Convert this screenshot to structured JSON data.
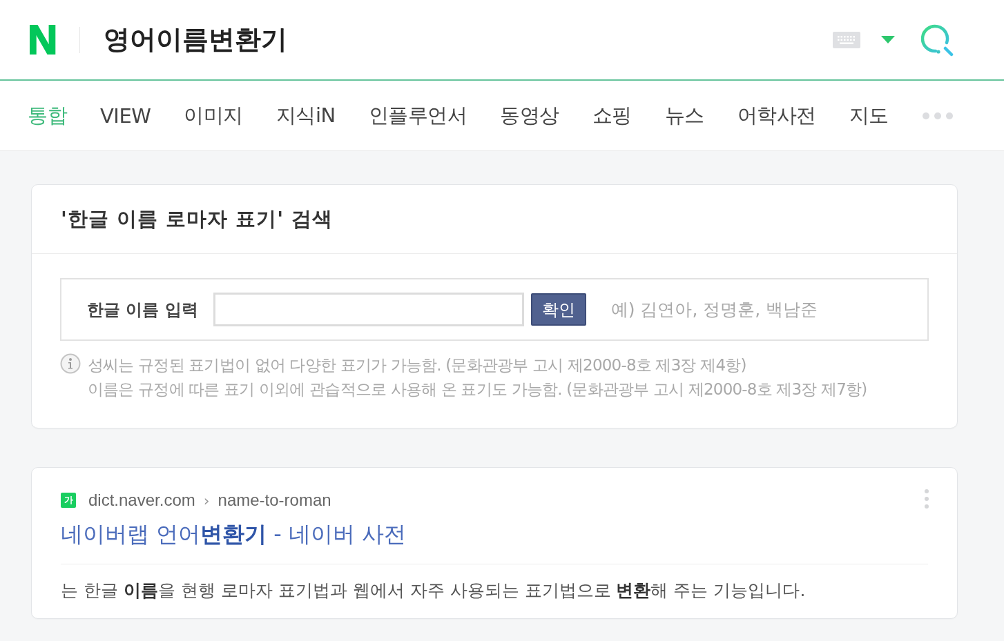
{
  "header": {
    "logo": "N",
    "query": "영어이름변환기"
  },
  "tabs": [
    {
      "label": "통합",
      "selected": true
    },
    {
      "label": "VIEW",
      "selected": false
    },
    {
      "label": "이미지",
      "selected": false
    },
    {
      "label": "지식iN",
      "selected": false
    },
    {
      "label": "인플루언서",
      "selected": false
    },
    {
      "label": "동영상",
      "selected": false
    },
    {
      "label": "쇼핑",
      "selected": false
    },
    {
      "label": "뉴스",
      "selected": false
    },
    {
      "label": "어학사전",
      "selected": false
    },
    {
      "label": "지도",
      "selected": false
    }
  ],
  "converter": {
    "title": "'한글 이름 로마자 표기' 검색",
    "label": "한글 이름 입력",
    "button": "확인",
    "example": "예) 김연아, 정명훈, 백남준",
    "notes": [
      "성씨는 규정된 표기법이 없어 다양한 표기가 가능함. (문화관광부 고시 제2000-8호 제3장 제4항)",
      "이름은 규정에 따른 표기 이외에 관습적으로 사용해 온 표기도 가능함. (문화관광부 고시 제2000-8호 제3장 제7항)"
    ]
  },
  "result": {
    "favicon": "가",
    "domain": "dict.naver.com",
    "separator": "›",
    "path": "name-to-roman",
    "title": "네이버랩 언어**변환기** - 네이버 사전",
    "description": "는 한글 **이름**을 현행 로마자 표기법과 웹에서 자주 사용되는 표기법으로 **변환**해 주는 기능입니다."
  }
}
